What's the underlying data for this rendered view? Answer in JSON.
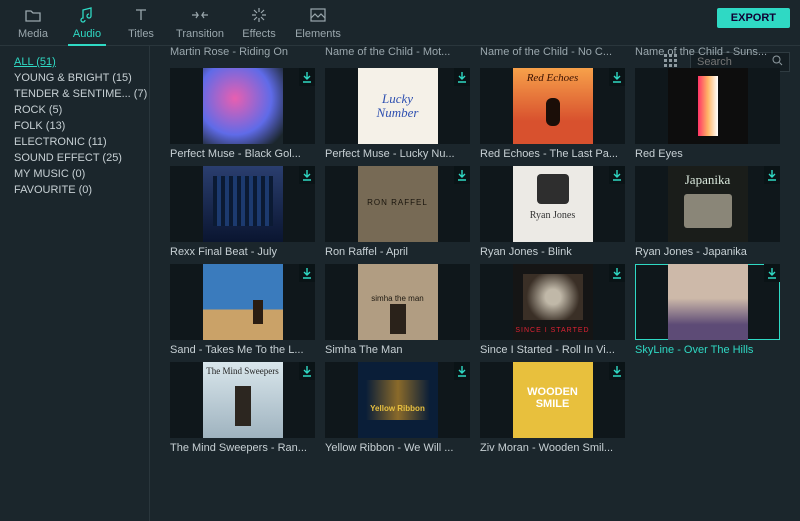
{
  "tabs": [
    {
      "id": "media",
      "label": "Media"
    },
    {
      "id": "audio",
      "label": "Audio"
    },
    {
      "id": "titles",
      "label": "Titles"
    },
    {
      "id": "transition",
      "label": "Transition"
    },
    {
      "id": "effects",
      "label": "Effects"
    },
    {
      "id": "elements",
      "label": "Elements"
    }
  ],
  "active_tab": "audio",
  "export_label": "EXPORT",
  "search": {
    "placeholder": "Search"
  },
  "categories": [
    {
      "label": "ALL (51)",
      "active": true
    },
    {
      "label": "YOUNG & BRIGHT (15)"
    },
    {
      "label": "TENDER & SENTIME... (7)"
    },
    {
      "label": "ROCK (5)"
    },
    {
      "label": "FOLK (13)"
    },
    {
      "label": "ELECTRONIC (11)"
    },
    {
      "label": "SOUND EFFECT (25)"
    },
    {
      "label": "MY MUSIC (0)"
    },
    {
      "label": "FAVOURITE (0)"
    }
  ],
  "partial_row": [
    "Martin Rose - Riding On",
    "Name of the Child - Mot...",
    "Name of the Child - No C...",
    "Name of the Child - Suns..."
  ],
  "items": [
    {
      "label": "Perfect Muse - Black Gol...",
      "dl": true,
      "art": "a0"
    },
    {
      "label": "Perfect Muse - Lucky Nu...",
      "dl": true,
      "art": "a1",
      "inner": "Lucky<br>Number"
    },
    {
      "label": "Red Echoes - The Last Pa...",
      "dl": true,
      "art": "a2"
    },
    {
      "label": "Red Eyes",
      "dl": false,
      "art": "a3"
    },
    {
      "label": "Rexx Final Beat - July",
      "dl": true,
      "art": "a4"
    },
    {
      "label": "Ron Raffel - April",
      "dl": true,
      "art": "a5"
    },
    {
      "label": "Ryan Jones - Blink",
      "dl": true,
      "art": "a6"
    },
    {
      "label": "Ryan Jones - Japanika",
      "dl": true,
      "art": "a7"
    },
    {
      "label": "Sand - Takes Me To the L...",
      "dl": true,
      "art": "a8"
    },
    {
      "label": "Simha The Man",
      "dl": false,
      "art": "a9"
    },
    {
      "label": "Since I Started - Roll In Vi...",
      "dl": true,
      "art": "a10"
    },
    {
      "label": "SkyLine - Over The Hills",
      "dl": true,
      "art": "a11",
      "selected": true
    },
    {
      "label": "The Mind Sweepers - Ran...",
      "dl": true,
      "art": "a12"
    },
    {
      "label": "Yellow Ribbon - We Will ...",
      "dl": true,
      "art": "a13"
    },
    {
      "label": "Ziv Moran - Wooden Smil...",
      "dl": true,
      "art": "a14"
    }
  ]
}
